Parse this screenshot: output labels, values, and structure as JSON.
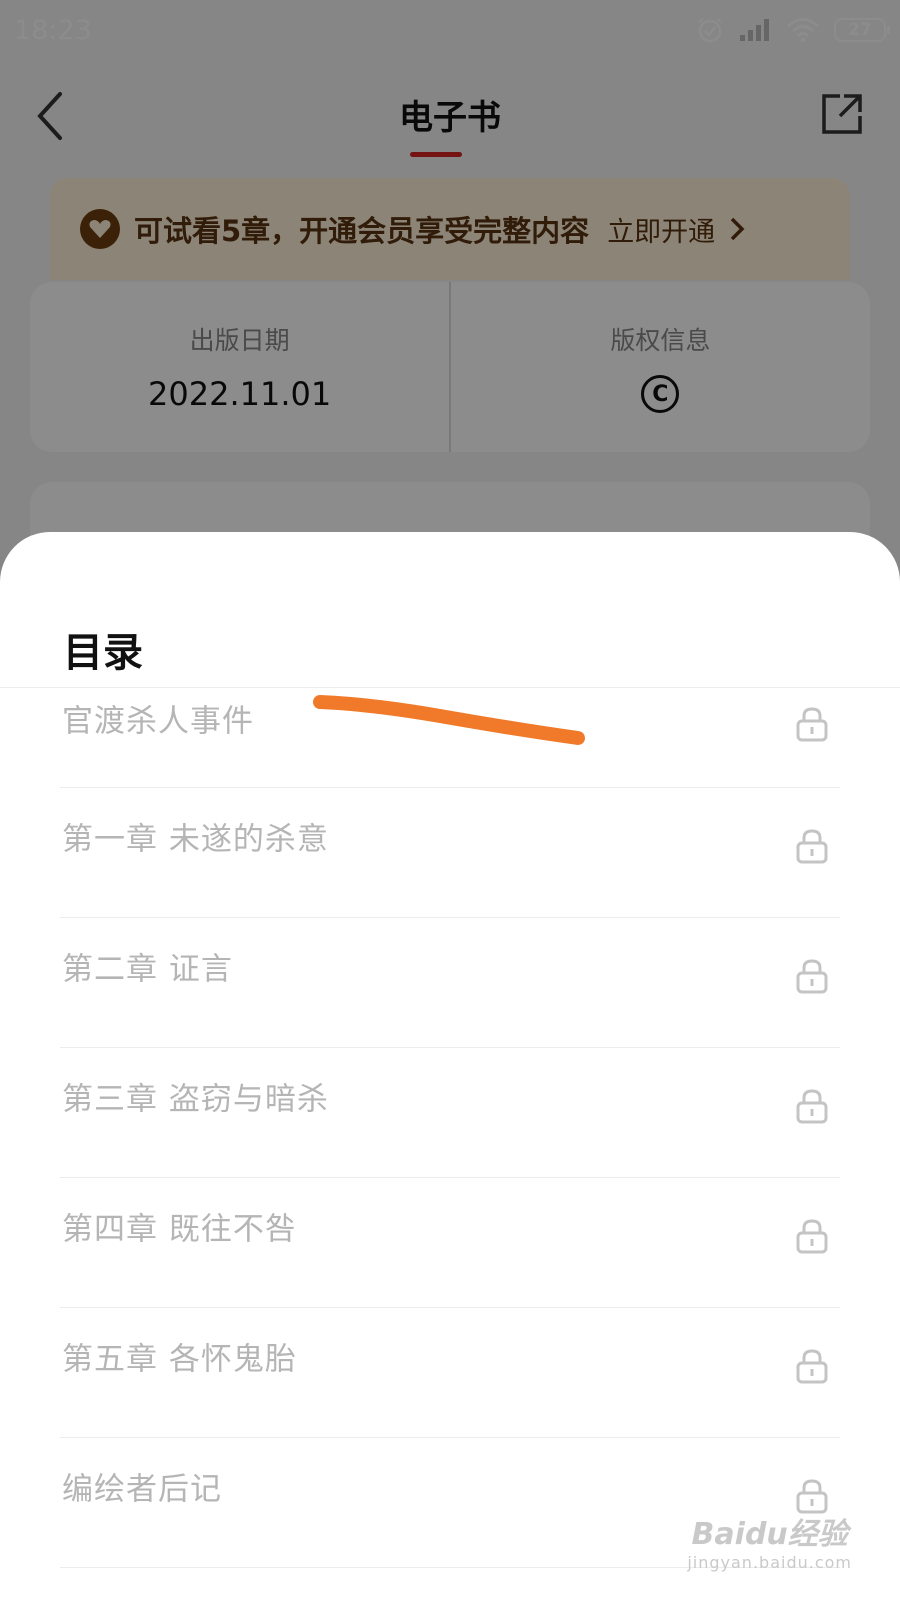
{
  "status_bar": {
    "time": "18:23",
    "battery": "27"
  },
  "nav": {
    "title": "电子书"
  },
  "vip_banner": {
    "text": "可试看5章，开通会员享受完整内容",
    "action": "立即开通"
  },
  "info": {
    "publish_date_label": "出版日期",
    "publish_date_value": "2022.11.01",
    "copyright_label": "版权信息",
    "copyright_symbol": "C"
  },
  "sheet": {
    "title": "目录",
    "items": [
      {
        "label": "官渡杀人事件",
        "locked": true
      },
      {
        "label": "第一章 未遂的杀意",
        "locked": true
      },
      {
        "label": "第二章 证言",
        "locked": true
      },
      {
        "label": "第三章 盗窃与暗杀",
        "locked": true
      },
      {
        "label": "第四章 既往不咎",
        "locked": true
      },
      {
        "label": "第五章 各怀鬼胎",
        "locked": true
      },
      {
        "label": "编绘者后记",
        "locked": true
      }
    ]
  },
  "watermark": {
    "main": "Baidu经验",
    "sub": "jingyan.baidu.com"
  },
  "colors": {
    "accent": "#d52222",
    "vip_bg": "#fff1d8",
    "vip_text": "#5a3412",
    "scribble": "#f07a2a",
    "item_text": "#b5b5b5"
  }
}
